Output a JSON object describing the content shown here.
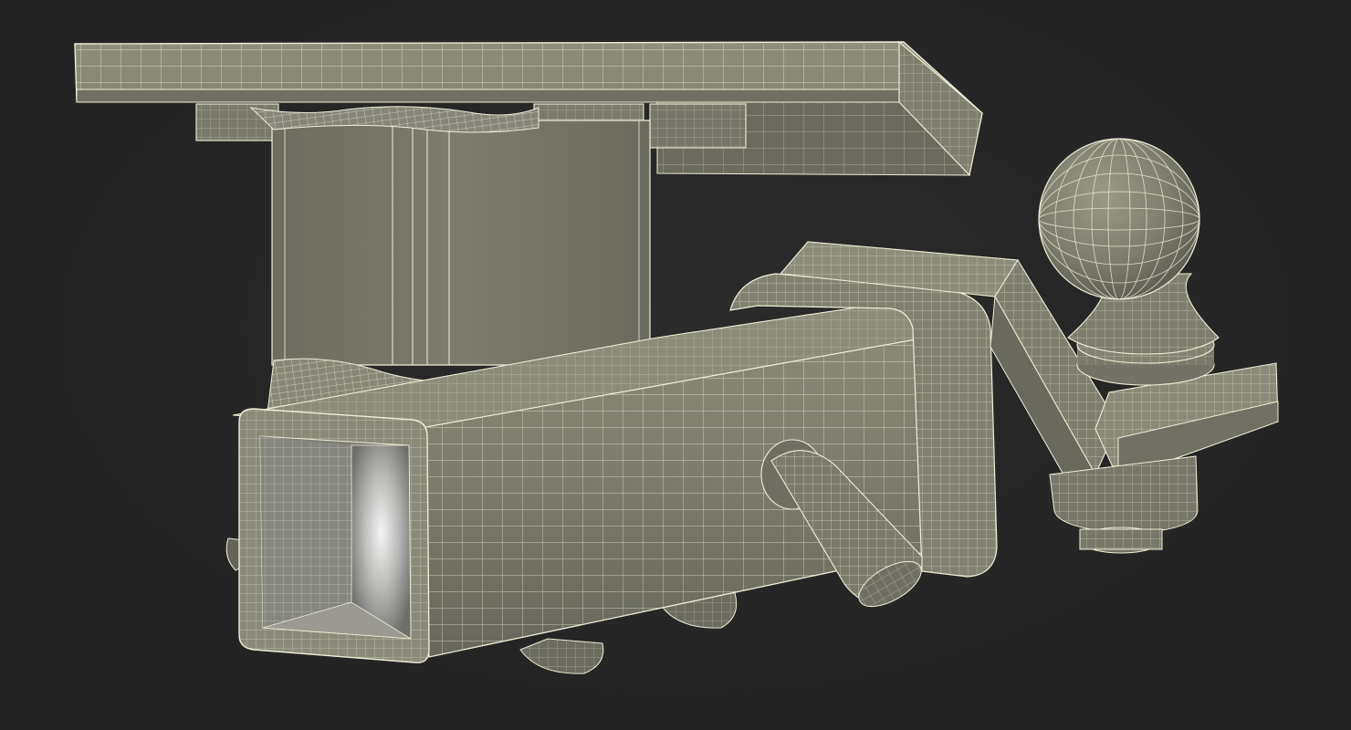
{
  "scene": {
    "subject": "trailer-hitch-receiver-with-ball-mount",
    "render_style": "wireframe-over-clay",
    "colors": {
      "background": "#262626",
      "surface_light": "#8c8c7a",
      "surface_mid": "#77776a",
      "surface_dark": "#5f5f56",
      "surface_shadow": "#45453f",
      "interior_highlight": "#e6e6e6",
      "wire": "#f0eed8"
    }
  }
}
